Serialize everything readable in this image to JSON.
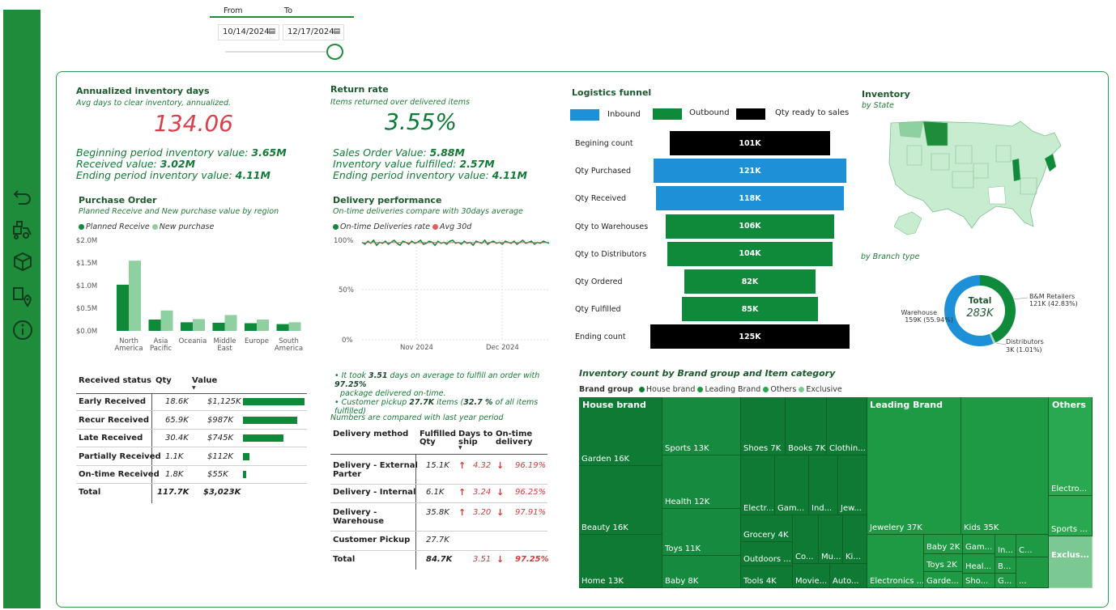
{
  "filter": {
    "from_label": "From",
    "to_label": "To",
    "from_value": "10/14/2024",
    "to_value": "12/17/2024"
  },
  "sidebar": {
    "icons": [
      "back-icon",
      "delivery-icon",
      "boxes-icon",
      "location-icon",
      "info-icon"
    ]
  },
  "aid": {
    "title": "Annualized inventory days",
    "subtitle": "Avg days to clear inventory, annualized.",
    "value": "134.06",
    "line1_label": "Beginning period inventory value: ",
    "line1_value": "3.65M",
    "line2_label": "Received value: ",
    "line2_value": "3.02M",
    "line3_label": "Ending period inventory value: ",
    "line3_value": "4.11M"
  },
  "rr": {
    "title": "Return rate",
    "subtitle": "Items returned over delivered items",
    "value": "3.55%",
    "line1_label": "Sales Order Value: ",
    "line1_value": "5.88M",
    "line2_label": "Inventory value fulfilled: ",
    "line2_value": "2.57M",
    "line3_label": "Ending period inventory value: ",
    "line3_value": "4.11M"
  },
  "po": {
    "title": "Purchase Order",
    "subtitle": "Planned Receive and New purchase value by region",
    "legend": [
      "Planned Receive",
      "New purchase"
    ],
    "y_ticks": [
      "$2.0M",
      "$1.5M",
      "$1.0M",
      "$0.5M",
      "$0.0M"
    ],
    "cats": [
      "North America",
      "Asia Pacific",
      "Oceania",
      "Middle East",
      "Europe",
      "South America"
    ],
    "cat_line1": [
      "North",
      "Asia",
      "Oceania",
      "Middle",
      "Europe",
      "South"
    ],
    "cat_line2": [
      "America",
      "Pacific",
      "",
      "East",
      "",
      "America"
    ]
  },
  "dp": {
    "title": "Delivery performance",
    "subtitle": "On-time deliveries compare with 30days average",
    "legend": [
      "On-time Deliveries rate",
      "Avg 30d"
    ],
    "y_ticks": [
      "100%",
      "50%",
      "0%"
    ],
    "x_ticks": [
      "Nov 2024",
      "Dec 2024"
    ]
  },
  "chart_data": [
    {
      "type": "bar",
      "title": "Purchase Order",
      "categories": [
        "North America",
        "Asia Pacific",
        "Oceania",
        "Middle East",
        "Europe",
        "South America"
      ],
      "series": [
        {
          "name": "Planned Receive",
          "values": [
            1.02,
            0.25,
            0.19,
            0.18,
            0.17,
            0.15
          ]
        },
        {
          "name": "New purchase",
          "values": [
            1.55,
            0.45,
            0.26,
            0.35,
            0.25,
            0.19
          ]
        }
      ],
      "ylim": [
        0,
        2.0
      ],
      "colors": [
        "#0e8a3a",
        "#8fd0a0"
      ]
    },
    {
      "type": "line",
      "title": "Delivery performance",
      "x_range": [
        "2024-10-14",
        "2024-12-17"
      ],
      "series": [
        {
          "name": "On-time Deliveries rate",
          "values": [
            98,
            96,
            99,
            97,
            100,
            95,
            98,
            97,
            99,
            96,
            98,
            100,
            97,
            95,
            99,
            98,
            96,
            99,
            97,
            98,
            100,
            96,
            97,
            99,
            98,
            95,
            99,
            97,
            98,
            96,
            99,
            100,
            97,
            98,
            96,
            99,
            97,
            98,
            95,
            99,
            98,
            97,
            100,
            96,
            98,
            99,
            97,
            98,
            96,
            99,
            98,
            97,
            99,
            96,
            98,
            100,
            97,
            98,
            99,
            96,
            98,
            97,
            99,
            98,
            97
          ]
        },
        {
          "name": "Avg 30d",
          "values": [
            97.5,
            97.6,
            97.7,
            97.6,
            97.8,
            97.7,
            97.6,
            97.8,
            97.7,
            97.6,
            97.7,
            97.8,
            97.6,
            97.7,
            97.8,
            97.7,
            97.6,
            97.7,
            97.8,
            97.7,
            97.6,
            97.8,
            97.7,
            97.6,
            97.7,
            97.8,
            97.7,
            97.6,
            97.7,
            97.8,
            97.6,
            97.7,
            97.8,
            97.7,
            97.6,
            97.7,
            97.8,
            97.7,
            97.6,
            97.7,
            97.8,
            97.7,
            97.6,
            97.7,
            97.8,
            97.7,
            97.6,
            97.7,
            97.8,
            97.7,
            97.6,
            97.7,
            97.8,
            97.7,
            97.6,
            97.7,
            97.8,
            97.7,
            97.6,
            97.7,
            97.8,
            97.7,
            97.6,
            97.7,
            97.8
          ]
        }
      ],
      "ylim": [
        0,
        100
      ],
      "colors": [
        "#0e8a3a",
        "#e06060"
      ]
    },
    {
      "type": "bar",
      "title": "Logistics funnel",
      "categories": [
        "Begining count",
        "Qty Purchased",
        "Qty Received",
        "Qty to Warehouses",
        "Qty to Distributors",
        "Qty Ordered",
        "Qty Fulfilled",
        "Ending count"
      ],
      "values": [
        101,
        121,
        118,
        106,
        104,
        82,
        85,
        125
      ],
      "labels": [
        "101K",
        "121K",
        "118K",
        "106K",
        "104K",
        "82K",
        "85K",
        "125K"
      ],
      "kinds": [
        "ready",
        "inbound",
        "inbound",
        "outbound",
        "outbound",
        "outbound",
        "outbound",
        "ready"
      ]
    },
    {
      "type": "pie",
      "title": "by Branch type",
      "labels": [
        "Warehouse",
        "B&M Retailers",
        "Distributors"
      ],
      "values": [
        159,
        121,
        3
      ],
      "percents": [
        "55.94%",
        "42.83%",
        "1.01%"
      ],
      "colors": [
        "#1e90d8",
        "#0e8a3a",
        "#a8d8b8"
      ]
    }
  ],
  "rs": {
    "headers": [
      "Received status",
      "Qty",
      "Value"
    ],
    "rows": [
      {
        "status": "Early Received",
        "qty": "18.6K",
        "value": "$1,125K",
        "bar": 1.0
      },
      {
        "status": "Recur Received",
        "qty": "65.9K",
        "value": "$987K",
        "bar": 0.88
      },
      {
        "status": "Late Received",
        "qty": "30.4K",
        "value": "$745K",
        "bar": 0.66
      },
      {
        "status": "Partially Received",
        "qty": "1.1K",
        "value": "$112K",
        "bar": 0.1
      },
      {
        "status": "On-time Received",
        "qty": "1.8K",
        "value": "$55K",
        "bar": 0.05
      }
    ],
    "total": {
      "status": "Total",
      "qty": "117.7K",
      "value": "$3,023K"
    }
  },
  "notes": {
    "n1a": "It took ",
    "n1b": "3.51",
    "n1c": " days on average to fulfill an order with ",
    "n1d": "97.25%",
    "n1e": "package delivered on-time.",
    "n2a": "Customer pickup ",
    "n2b": "27.7K",
    "n2c": " items (",
    "n2d": "32.7 %",
    "n2e": " of all items fulfilled)",
    "compare": "Numbers are compared with last year period"
  },
  "dm": {
    "headers": [
      "Delivery method",
      "Fulfilled Qty",
      "Days to ship",
      "On-time delivery"
    ],
    "h1": [
      "Fulfilled",
      "Days to",
      "On-time"
    ],
    "h2": [
      "Qty",
      "ship",
      "delivery"
    ],
    "rows": [
      {
        "method1": "Delivery - External",
        "method2": "Parter",
        "qty": "15.1K",
        "days": "4.32",
        "ontime": "96.19%"
      },
      {
        "method1": "Delivery - Internal",
        "method2": "",
        "qty": "6.1K",
        "days": "3.24",
        "ontime": "96.25%"
      },
      {
        "method1": "Delivery -",
        "method2": "Warehouse",
        "qty": "35.8K",
        "days": "3.20",
        "ontime": "97.91%"
      },
      {
        "method1": "Customer Pickup",
        "method2": "",
        "qty": "27.7K",
        "days": "",
        "ontime": ""
      }
    ],
    "total": {
      "method": "Total",
      "qty": "84.7K",
      "days": "3.51",
      "ontime": "97.25%"
    }
  },
  "funnel": {
    "title": "Logistics funnel",
    "legend": [
      "Inbound",
      "Outbound",
      "Qty ready to sales"
    ],
    "colors": {
      "inbound": "#1e90d8",
      "outbound": "#0e8a3a",
      "ready": "#000000"
    }
  },
  "inv": {
    "title": "Inventory",
    "subtitle": "by State",
    "branch_title": "by Branch type",
    "donut_total_label": "Total",
    "donut_total": "283K",
    "labels": [
      {
        "name": "Warehouse",
        "val": "159K (55.94%)"
      },
      {
        "name": "B&M Retailers",
        "val": "121K (42.83%)"
      },
      {
        "name": "Distributors",
        "val": "3K (1.01%)"
      }
    ]
  },
  "tm": {
    "title": "Inventory count by Brand group and Item category",
    "legend_label": "Brand group",
    "legend": [
      "House brand",
      "Leading Brand",
      "Others",
      "Exclusive"
    ],
    "groups": [
      "House brand",
      "Leading Brand",
      "Others"
    ],
    "cells": [
      "Garden 16K",
      "Beauty 16K",
      "Home 13K",
      "Sports 13K",
      "Health 12K",
      "Toys 11K",
      "Baby 8K",
      "Shoes 7K",
      "Books 7K",
      "Clothin...",
      "Electr...",
      "Gam...",
      "Ind...",
      "Jew...",
      "Grocery 4K",
      "Outdoors ...",
      "Co...",
      "Mu...",
      "Ki...",
      "Tools 4K",
      "Movie...",
      "Auto...",
      "Jewelery 37K",
      "Kids 35K",
      "Electronics ...",
      "Baby 2K",
      "Gam...",
      "In...",
      "C...",
      "Toys 2K",
      "Heal...",
      "B...",
      "Garde...",
      "Sho...",
      "G...",
      "...",
      "Electro...",
      "Sports ...",
      "Exclus..."
    ]
  }
}
